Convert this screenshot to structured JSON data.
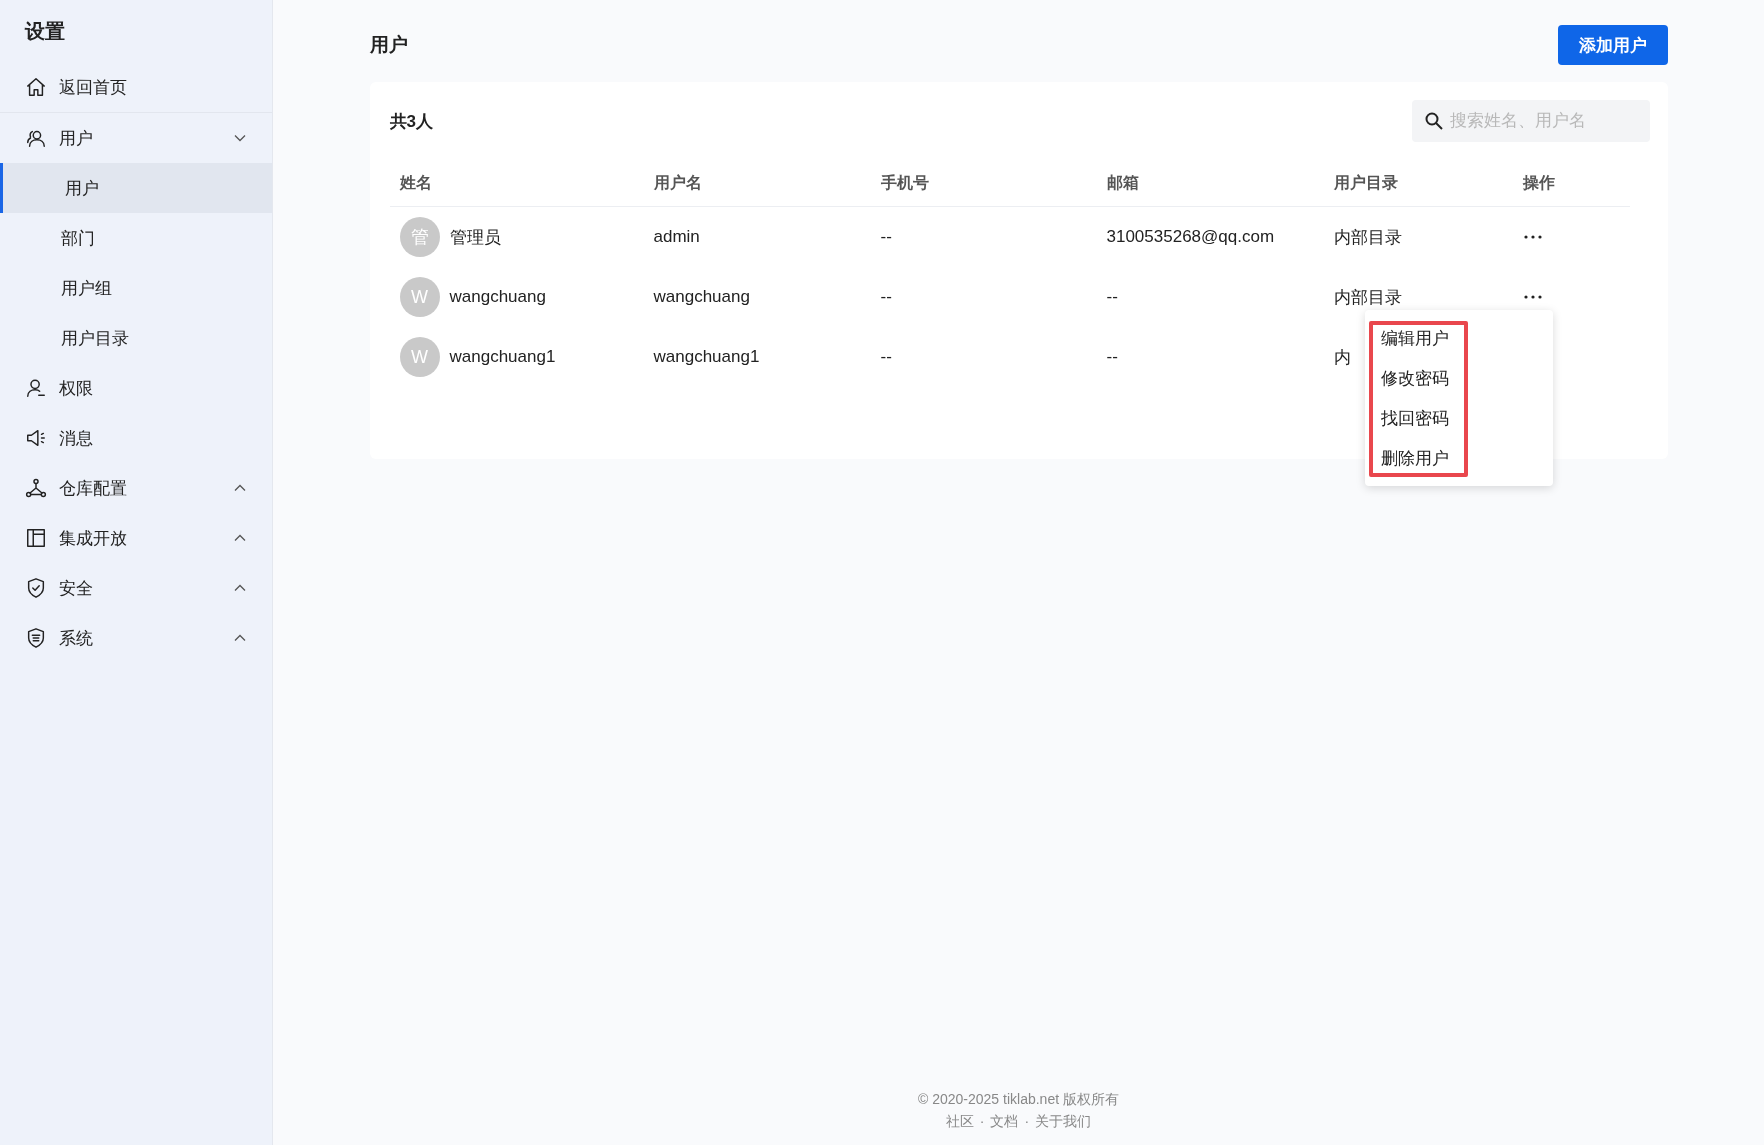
{
  "sidebar": {
    "title": "设置",
    "items": [
      {
        "kind": "link",
        "label": "返回首页"
      },
      {
        "kind": "group",
        "label": "用户",
        "expanded": true,
        "children": [
          {
            "label": "用户",
            "selected": true
          },
          {
            "label": "部门",
            "selected": false
          },
          {
            "label": "用户组",
            "selected": false
          },
          {
            "label": "用户目录",
            "selected": false
          }
        ]
      },
      {
        "kind": "link",
        "label": "权限"
      },
      {
        "kind": "link",
        "label": "消息"
      },
      {
        "kind": "group",
        "label": "仓库配置",
        "expanded": false
      },
      {
        "kind": "group",
        "label": "集成开放",
        "expanded": false
      },
      {
        "kind": "group",
        "label": "安全",
        "expanded": false
      },
      {
        "kind": "group",
        "label": "系统",
        "expanded": false
      }
    ]
  },
  "page": {
    "title": "用户",
    "add_button": "添加用户"
  },
  "table": {
    "count": "共3人",
    "search": {
      "placeholder": "搜索姓名、用户名"
    },
    "columns": [
      "姓名",
      "用户名",
      "手机号",
      "邮箱",
      "用户目录",
      "操作"
    ],
    "rows": [
      {
        "avatar": "管",
        "name": "管理员",
        "username": "admin",
        "phone": "--",
        "email": "3100535268@qq.com",
        "directory": "内部目录",
        "actions_hidden": false
      },
      {
        "avatar": "W",
        "name": "wangchuang",
        "username": "wangchuang",
        "phone": "--",
        "email": "--",
        "directory": "内部目录",
        "actions_hidden": false
      },
      {
        "avatar": "W",
        "name": "wangchuang1",
        "username": "wangchuang1",
        "phone": "--",
        "email": "--",
        "directory": "内",
        "actions_hidden": true
      }
    ]
  },
  "menu": {
    "items": [
      "编辑用户",
      "修改密码",
      "找回密码",
      "删除用户"
    ]
  },
  "footer": {
    "copyright": "© 2020-2025 tiklab.net 版权所有",
    "links": [
      "社区",
      "文档",
      "关于我们"
    ],
    "separator": "·"
  }
}
